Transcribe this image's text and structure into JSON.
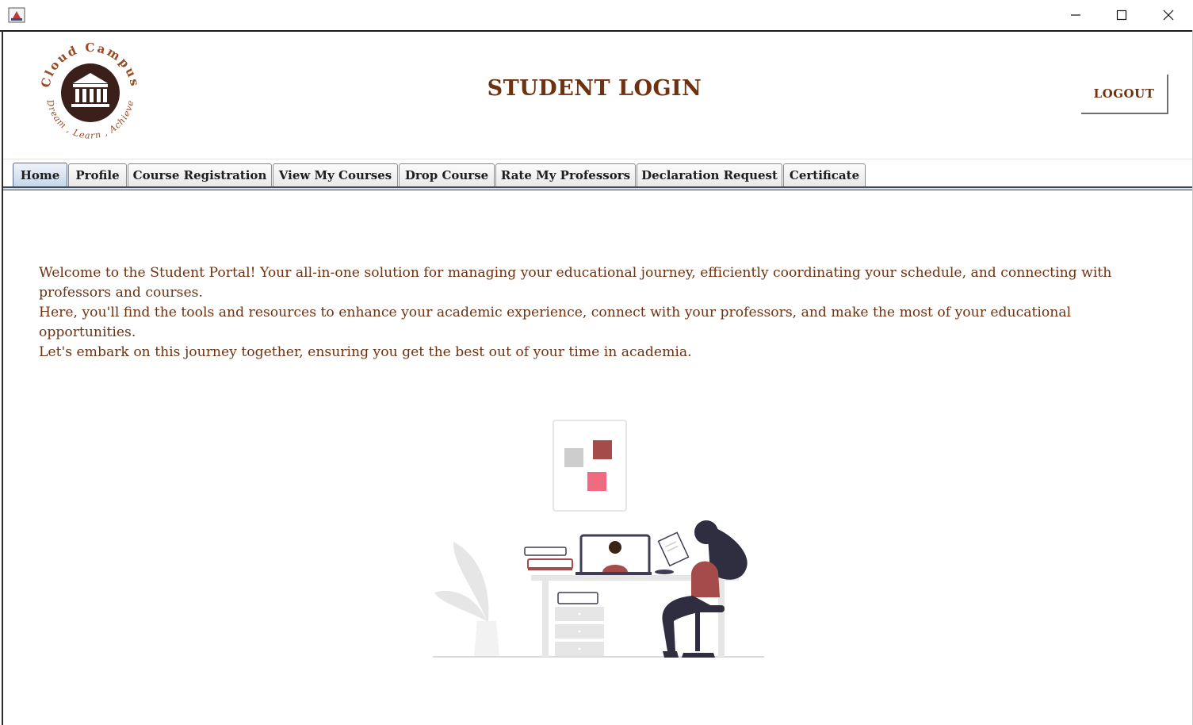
{
  "window": {
    "controls": [
      "minimize",
      "maximize",
      "close"
    ]
  },
  "logo": {
    "top_text": "Cloud Campus",
    "bottom_text": "Dream , Learn , Achieve",
    "icon": "institution-icon"
  },
  "header": {
    "title": "STUDENT LOGIN",
    "logout_label": "LOGOUT"
  },
  "tabs": [
    {
      "label": "Home",
      "active": true
    },
    {
      "label": "Profile",
      "active": false
    },
    {
      "label": "Course Registration",
      "active": false
    },
    {
      "label": "View My Courses",
      "active": false
    },
    {
      "label": "Drop Course",
      "active": false
    },
    {
      "label": "Rate My Professors",
      "active": false
    },
    {
      "label": "Declaration Request",
      "active": false
    },
    {
      "label": "Certificate",
      "active": false
    }
  ],
  "content": {
    "welcome_line1": "Welcome to the Student Portal! Your all-in-one solution for managing your educational journey, efficiently coordinating your schedule, and connecting with professors and courses.",
    "welcome_line2": "Here, you'll find the tools and resources to enhance your academic experience, connect with your professors, and make the most of your educational opportunities.",
    "welcome_line3": "Let's embark on this journey together, ensuring you get the best out of your time in academia."
  },
  "colors": {
    "brand_brown": "#6e3210",
    "logo_dark": "#3b1f1a",
    "accent_red": "#a54b4b",
    "accent_pink": "#f06a80",
    "figure_dark": "#2f2e41"
  }
}
